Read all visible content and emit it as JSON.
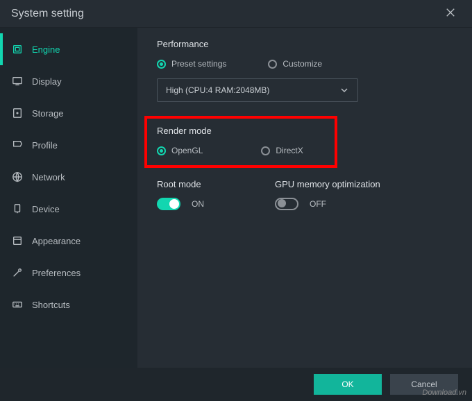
{
  "window": {
    "title": "System setting"
  },
  "sidebar": {
    "items": [
      {
        "label": "Engine"
      },
      {
        "label": "Display"
      },
      {
        "label": "Storage"
      },
      {
        "label": "Profile"
      },
      {
        "label": "Network"
      },
      {
        "label": "Device"
      },
      {
        "label": "Appearance"
      },
      {
        "label": "Preferences"
      },
      {
        "label": "Shortcuts"
      }
    ],
    "active_index": 0
  },
  "main": {
    "performance": {
      "title": "Performance",
      "preset_label": "Preset settings",
      "customize_label": "Customize",
      "selected": "preset",
      "dropdown_value": "High (CPU:4 RAM:2048MB)"
    },
    "render_mode": {
      "title": "Render mode",
      "opengl_label": "OpenGL",
      "directx_label": "DirectX",
      "selected": "opengl"
    },
    "root_mode": {
      "title": "Root mode",
      "value": true,
      "on_label": "ON"
    },
    "gpu_opt": {
      "title": "GPU memory optimization",
      "value": false,
      "off_label": "OFF"
    }
  },
  "footer": {
    "ok_label": "OK",
    "cancel_label": "Cancel"
  },
  "watermark": "Download.vn",
  "colors": {
    "accent": "#12d6b0",
    "highlight": "#ff0000"
  }
}
